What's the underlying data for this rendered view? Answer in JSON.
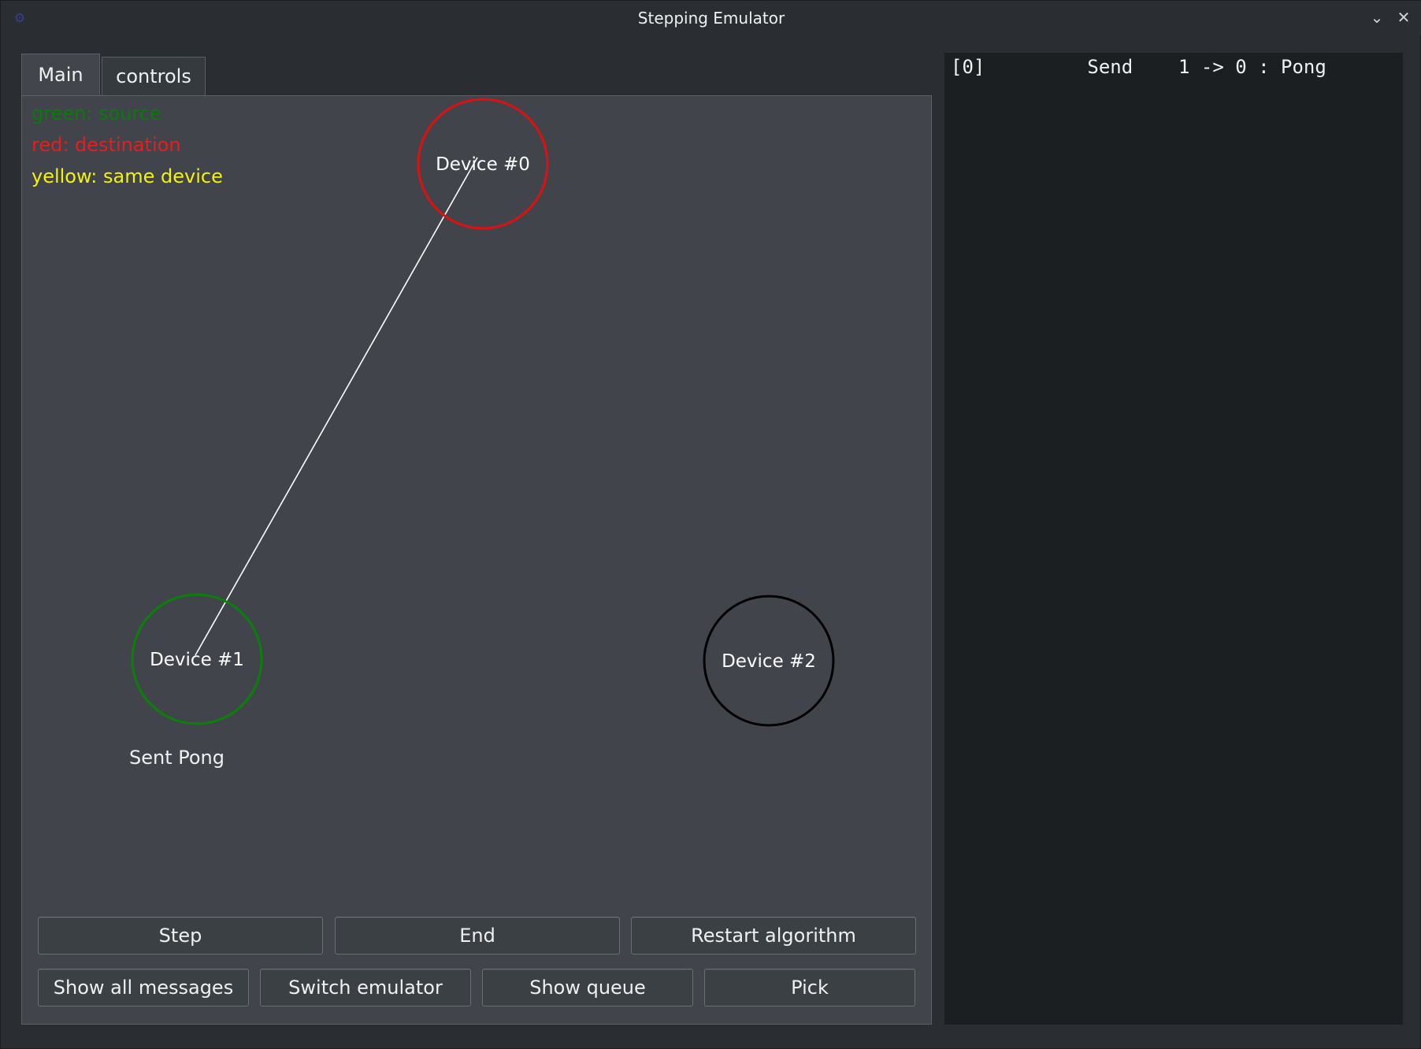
{
  "window": {
    "title": "Stepping Emulator",
    "app_icon": "kde-app-icon",
    "minimize_icon": "⌄",
    "close_icon": "✕"
  },
  "tabs": [
    {
      "label": "Main",
      "active": true
    },
    {
      "label": "controls",
      "active": false
    }
  ],
  "legend": {
    "source": "green: source",
    "destination": "red: destination",
    "same": "yellow: same device"
  },
  "devices": [
    {
      "label": "Device #0",
      "state": "destination",
      "color": "#e01010"
    },
    {
      "label": "Device #1",
      "state": "source",
      "color": "#0a800a"
    },
    {
      "label": "Device #2",
      "state": "idle",
      "color": "#000000"
    }
  ],
  "status_text": "Sent Pong",
  "buttons": {
    "step": "Step",
    "end": "End",
    "restart": "Restart algorithm",
    "show_all": "Show all messages",
    "switch_emulator": "Switch emulator",
    "show_queue": "Show queue",
    "pick": "Pick"
  },
  "log": [
    "[0]         Send    1 -> 0 : Pong"
  ],
  "colors": {
    "background": "#2a2e32",
    "panel": "#41454b",
    "log_background": "#1c1f21"
  }
}
